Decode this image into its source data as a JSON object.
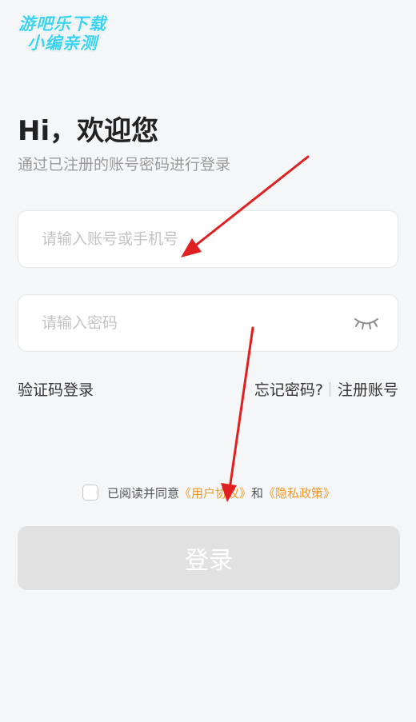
{
  "watermark": {
    "line1": "游吧乐下载",
    "line2": "小编亲测"
  },
  "header": {
    "title": "Hi，欢迎您",
    "subtitle": "通过已注册的账号密码进行登录"
  },
  "form": {
    "account_placeholder": "请输入账号或手机号",
    "account_value": "",
    "password_placeholder": "请输入密码",
    "password_value": ""
  },
  "links": {
    "sms_login": "验证码登录",
    "forgot_password": "忘记密码?",
    "register": "注册账号"
  },
  "agreement": {
    "checked": false,
    "prefix": "已阅读并同意",
    "user_agreement": "《用户协议》",
    "and": "和",
    "privacy_policy": "《隐私政策》"
  },
  "login_button": {
    "label": "登录",
    "enabled": false
  },
  "icons": {
    "password_toggle": "eye-closed-icon",
    "annotation": "arrow-icon"
  },
  "colors": {
    "background": "#f5f6f8",
    "link_orange": "#f19a2c",
    "button_disabled": "#e1e1e1",
    "annotation_arrow": "#e02020",
    "watermark": "#3ad2f0"
  }
}
